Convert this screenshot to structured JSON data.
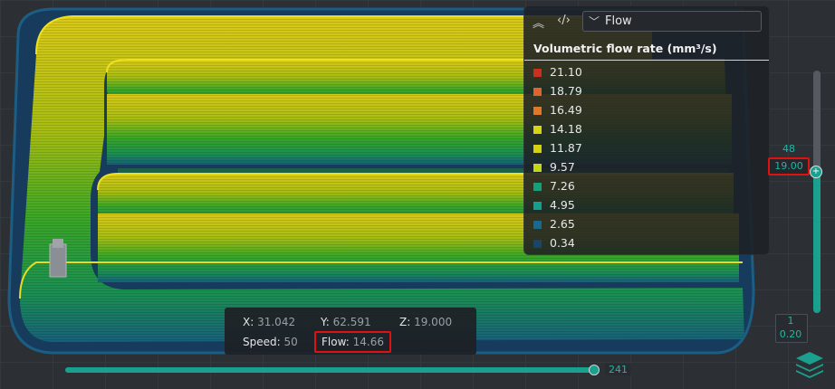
{
  "legend": {
    "view_select": "Flow",
    "title": "Volumetric flow rate (mm³/s)",
    "items": [
      {
        "label": "21.10",
        "color": "#c9301f"
      },
      {
        "label": "18.79",
        "color": "#e0632b"
      },
      {
        "label": "16.49",
        "color": "#e0782c"
      },
      {
        "label": "14.18",
        "color": "#d8d40e"
      },
      {
        "label": "11.87",
        "color": "#d5d10f"
      },
      {
        "label": "9.57",
        "color": "#c2d912"
      },
      {
        "label": "7.26",
        "color": "#13a07a"
      },
      {
        "label": "4.95",
        "color": "#14a090"
      },
      {
        "label": "2.65",
        "color": "#176a8d"
      },
      {
        "label": "0.34",
        "color": "#15476e"
      }
    ]
  },
  "vslider": {
    "top_layer": "48",
    "top_z": "19.00",
    "bottom_layer": "1",
    "bottom_z": "0.20"
  },
  "hslider": {
    "value": "241"
  },
  "info": {
    "x_label": "X:",
    "x_value": "31.042",
    "y_label": "Y:",
    "y_value": "62.591",
    "z_label": "Z:",
    "z_value": "19.000",
    "speed_label": "Speed:",
    "speed_value": "50",
    "flow_label": "Flow:",
    "flow_value": "14.66"
  },
  "colors": {
    "accent": "#19a08e",
    "highlight": "#e01111"
  }
}
